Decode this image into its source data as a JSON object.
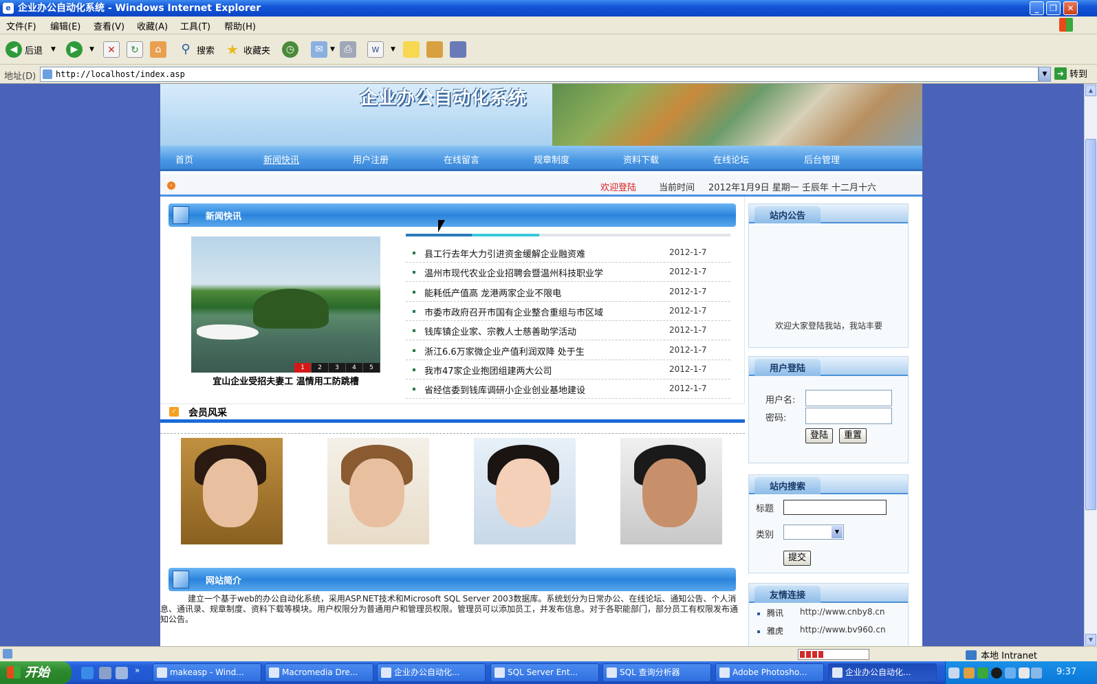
{
  "window": {
    "title": "企业办公自动化系统 - Windows Internet Explorer",
    "buttons": {
      "minimize": "_",
      "restore": "❐",
      "close": "✕"
    }
  },
  "menu": [
    "文件(F)",
    "编辑(E)",
    "查看(V)",
    "收藏(A)",
    "工具(T)",
    "帮助(H)"
  ],
  "toolbar": {
    "back": "后退",
    "search": "搜索",
    "favorites": "收藏夹"
  },
  "address": {
    "label": "地址(D)",
    "url": "http://localhost/index.asp",
    "go": "转到"
  },
  "site": {
    "title": "企业办公自动化系统",
    "nav": [
      "首页",
      "新闻快讯",
      "用户注册",
      "在线留言",
      "规章制度",
      "资料下载",
      "在线论坛",
      "后台管理"
    ],
    "active_nav": 1,
    "welcome": "欢迎登陆",
    "time_label": "当前时间",
    "time_value": "2012年1月9日 星期一 壬辰年 十二月十六"
  },
  "news": {
    "title": "新闻快讯",
    "photo_caption": "宜山企业受招夫妻工 温情用工防跳槽",
    "photo_tabs": [
      "1",
      "2",
      "3",
      "4",
      "5"
    ],
    "active_tab": 0,
    "items": [
      {
        "title": "县工行去年大力引进资金缓解企业融资难",
        "date": "2012-1-7"
      },
      {
        "title": "温州市现代农业企业招聘会暨温州科技职业学",
        "date": "2012-1-7"
      },
      {
        "title": "能耗低产值高 龙港两家企业不限电",
        "date": "2012-1-7"
      },
      {
        "title": "市委市政府召开市国有企业整合重组与市区域",
        "date": "2012-1-7"
      },
      {
        "title": "钱库镇企业家、宗教人士慈善助学活动",
        "date": "2012-1-7"
      },
      {
        "title": "浙江6.6万家微企业产值利润双降 处于生",
        "date": "2012-1-7"
      },
      {
        "title": "我市47家企业抱团组建两大公司",
        "date": "2012-1-7"
      },
      {
        "title": "省经信委到钱库调研小企业创业基地建设",
        "date": "2012-1-7"
      }
    ]
  },
  "members": {
    "title": "会员风采",
    "count": 4
  },
  "intro": {
    "title": "网站简介",
    "text": "建立一个基于web的办公自动化系统，采用ASP.NET技术和Microsoft SQL Server 2003数据库。系统划分为日常办公、在线论坛、通知公告、个人消息、通讯录、规章制度、资料下载等模块。用户权限分为普通用户和管理员权限。管理员可以添加员工，并发布信息。对于各职能部门，部分员工有权限发布通知公告。"
  },
  "notice": {
    "title": "站内公告",
    "text": "欢迎大家登陆我站，我站丰要"
  },
  "login": {
    "title": "用户登陆",
    "username_label": "用户名:",
    "password_label": "密码:",
    "login_button": "登陆",
    "reset_button": "重置"
  },
  "search": {
    "title": "站内搜索",
    "title_label": "标题",
    "category_label": "类别",
    "submit_button": "提交"
  },
  "links": {
    "title": "友情连接",
    "items": [
      {
        "name": "腾讯",
        "url": "http://www.cnby8.cn"
      },
      {
        "name": "雅虎",
        "url": "http://www.bv960.cn"
      }
    ]
  },
  "status": {
    "zone": "本地 Intranet",
    "progress": 0.35
  },
  "taskbar": {
    "start": "开始",
    "tasks": [
      "makeasp - Wind...",
      "Macromedia Dre...",
      "企业办公自动化...",
      "SQL Server Ent...",
      "SQL 查询分析器",
      "Adobe Photosho...",
      "企业办公自动化..."
    ],
    "active_task": 6,
    "clock": "9:37"
  }
}
